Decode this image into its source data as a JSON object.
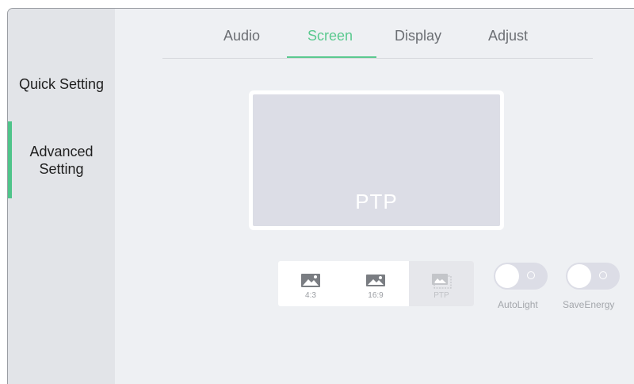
{
  "sidebar": {
    "items": [
      {
        "label": "Quick Setting"
      },
      {
        "label_line1": "Advanced",
        "label_line2": "Setting"
      }
    ]
  },
  "tabs": [
    {
      "label": "Audio"
    },
    {
      "label": "Screen",
      "active": true
    },
    {
      "label": "Display"
    },
    {
      "label": "Adjust"
    }
  ],
  "preview": {
    "label": "PTP"
  },
  "aspect_ratio": {
    "options": [
      {
        "label": "4:3",
        "icon": "image-icon"
      },
      {
        "label": "16:9",
        "icon": "image-icon"
      },
      {
        "label": "PTP",
        "icon": "image-crop-icon",
        "state": "disabled"
      }
    ]
  },
  "toggles": [
    {
      "label": "AutoLight",
      "state": "off"
    },
    {
      "label": "SaveEnergy",
      "state": "off"
    }
  ],
  "colors": {
    "accent": "#5bc98f",
    "background": "#eef0f3",
    "sidebar": "#e2e4e8",
    "preview": "#dcdde6"
  }
}
